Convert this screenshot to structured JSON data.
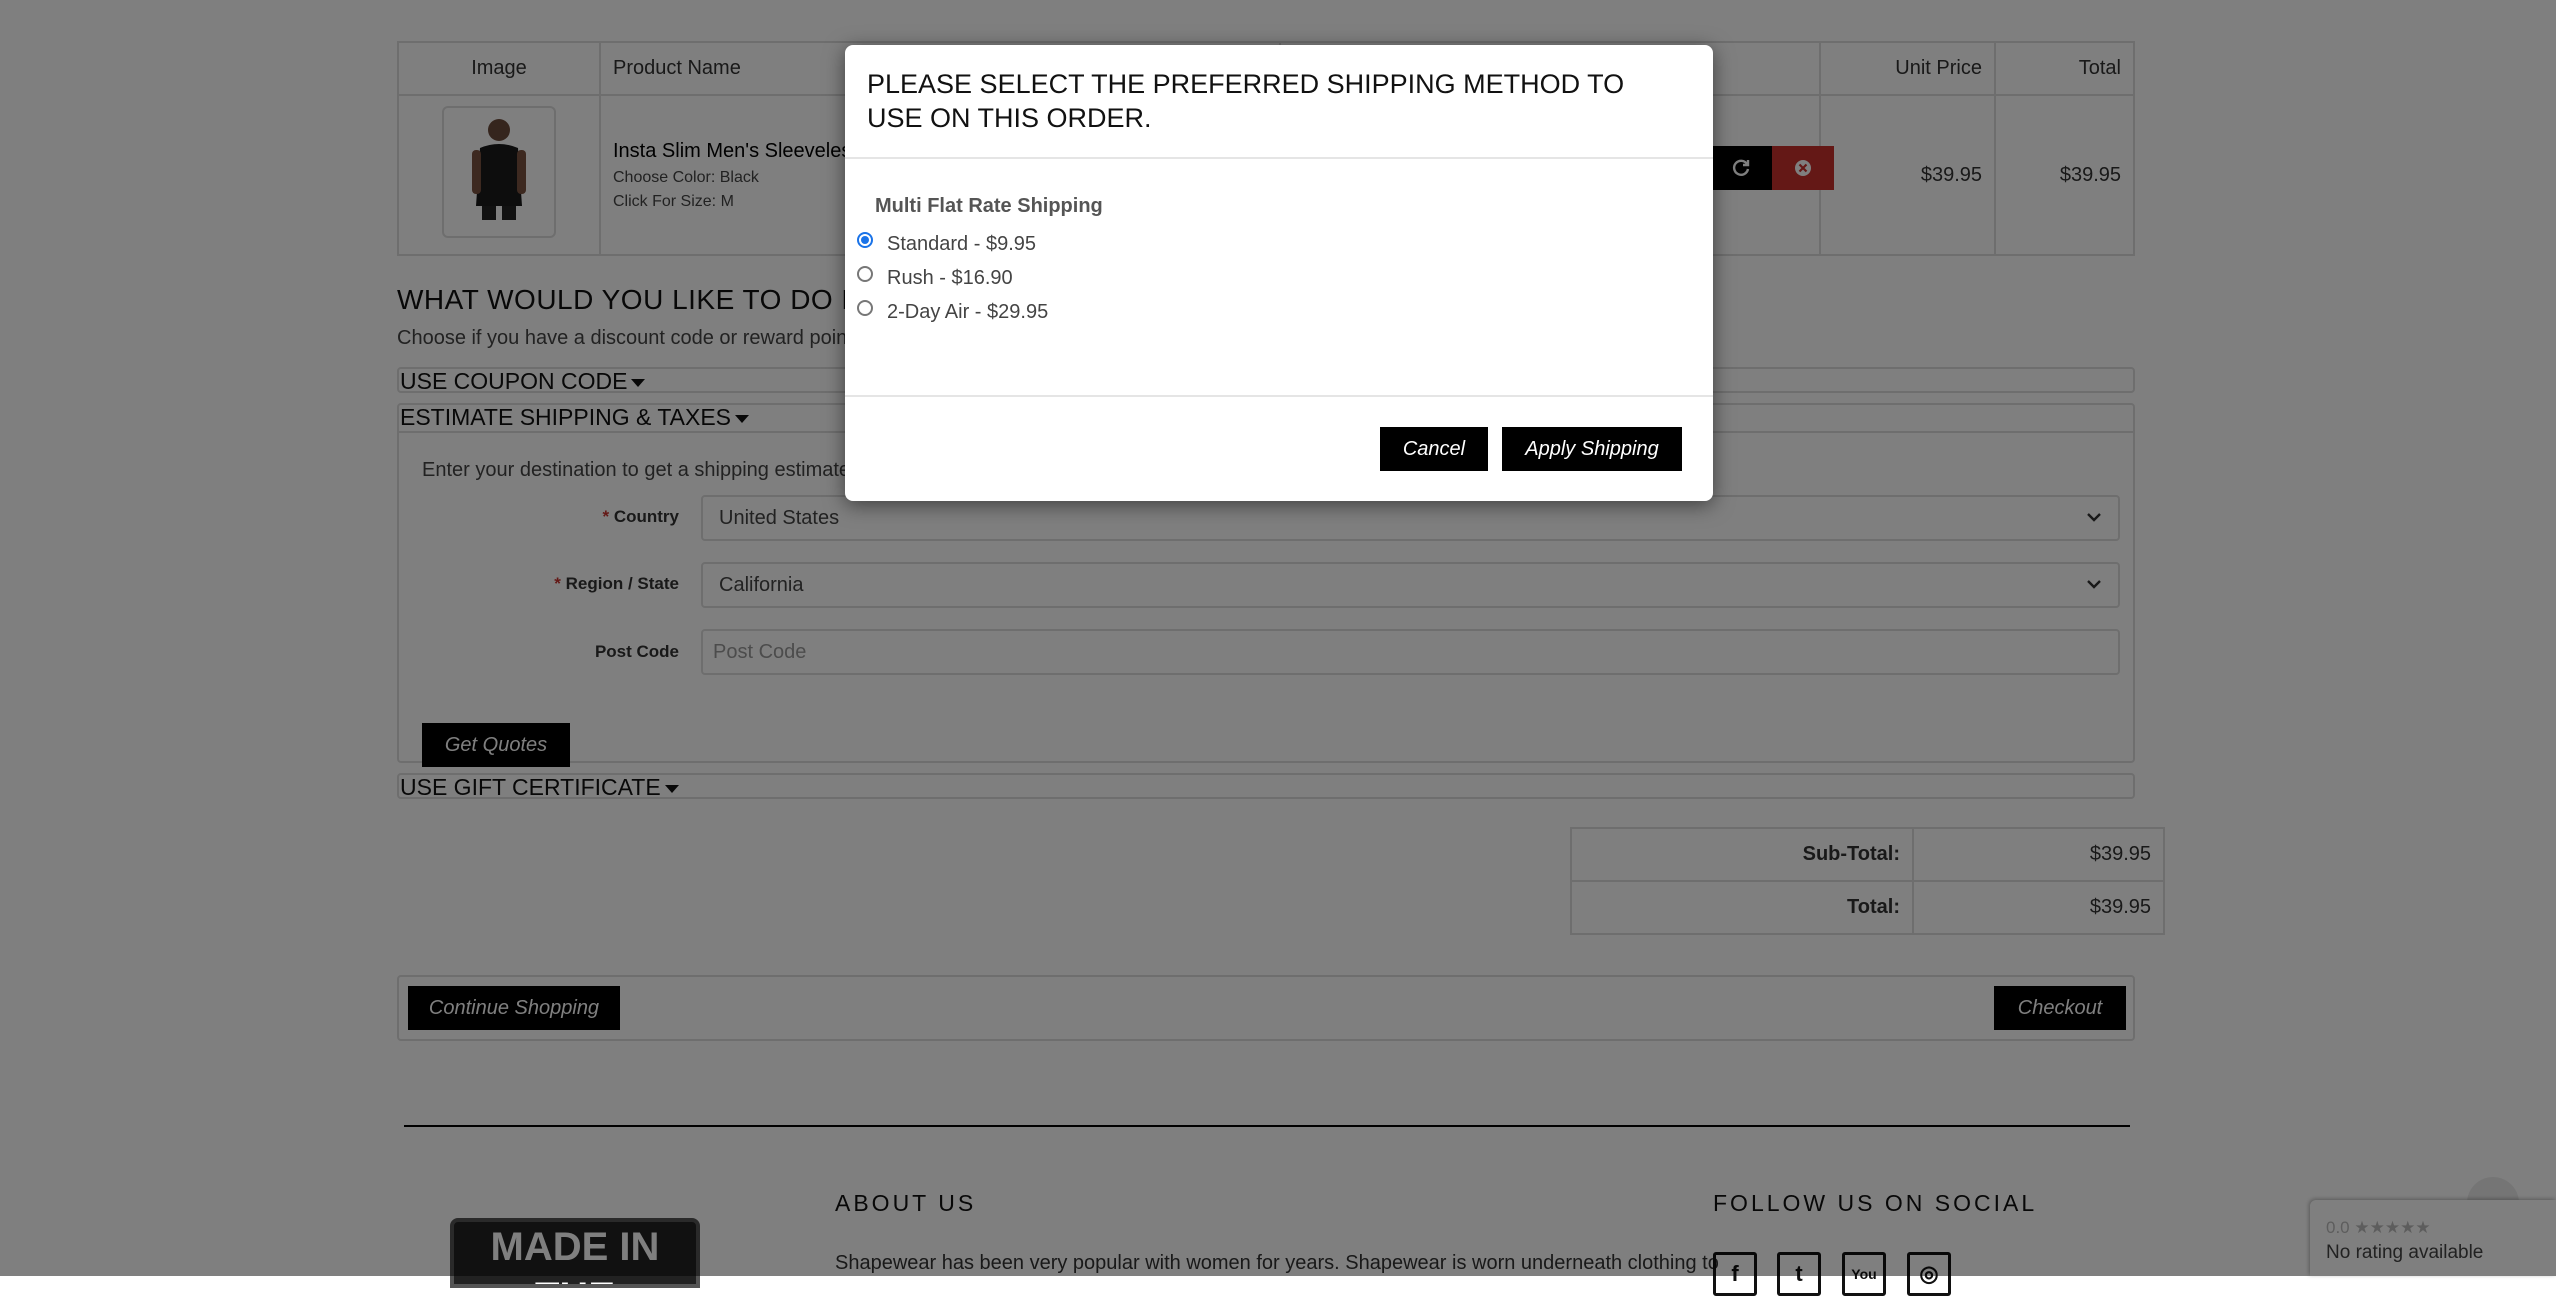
{
  "cart": {
    "headers": {
      "image": "Image",
      "product_name": "Product Name",
      "unit_price": "Unit Price",
      "total": "Total"
    },
    "item": {
      "name": "Insta Slim Men's Sleeveless",
      "option_color": "Choose Color: Black",
      "option_size": "Click For Size: M",
      "unit_price": "$39.95",
      "total": "$39.95"
    }
  },
  "next": {
    "title": "WHAT WOULD YOU LIKE TO DO NEX",
    "description": "Choose if you have a discount code or reward points"
  },
  "coupon": {
    "label": "USE COUPON CODE"
  },
  "shipping_estimate": {
    "label": "ESTIMATE SHIPPING & TAXES",
    "intro": "Enter your destination to get a shipping estimate.",
    "country_label": "Country",
    "country_value": "United States",
    "region_label": "Region / State",
    "region_value": "California",
    "postcode_label": "Post Code",
    "postcode_placeholder": "Post Code",
    "required_mark": "*",
    "get_quotes": "Get Quotes"
  },
  "gift": {
    "label": "USE GIFT CERTIFICATE"
  },
  "totals": {
    "subtotal_label": "Sub-Total:",
    "subtotal_value": "$39.95",
    "total_label": "Total:",
    "total_value": "$39.95"
  },
  "actions": {
    "continue": "Continue Shopping",
    "checkout": "Checkout"
  },
  "footer": {
    "logo_text": "MADE IN THE",
    "about_title": "ABOUT US",
    "about_text": "Shapewear has been very popular with women for years. Shapewear is worn underneath clothing to",
    "social_title": "FOLLOW US ON SOCIAL",
    "social": [
      {
        "icon": "facebook-icon",
        "glyph": "f"
      },
      {
        "icon": "twitter-icon",
        "glyph": "t"
      },
      {
        "icon": "youtube-icon",
        "glyph": "You"
      },
      {
        "icon": "instagram-icon",
        "glyph": "◎"
      }
    ]
  },
  "rating": {
    "score": "0.0",
    "stars": "★★★★★",
    "text": "No rating available"
  },
  "modal": {
    "title": "PLEASE SELECT THE PREFERRED SHIPPING METHOD TO USE ON THIS ORDER.",
    "group": "Multi Flat Rate Shipping",
    "options": [
      {
        "label": "Standard - $9.95",
        "checked": true
      },
      {
        "label": "Rush - $16.90",
        "checked": false
      },
      {
        "label": "2-Day Air - $29.95",
        "checked": false
      }
    ],
    "cancel": "Cancel",
    "apply": "Apply Shipping"
  },
  "colors": {
    "accent": "#000000",
    "danger": "#c9302c",
    "radio": "#1a73e8"
  }
}
